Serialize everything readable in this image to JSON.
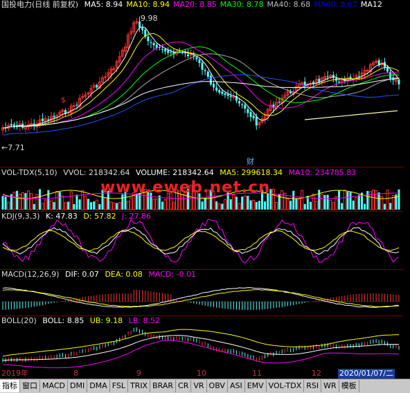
{
  "main": {
    "title": "国投电力(日线 前复权)",
    "ma": [
      {
        "label": "MA5: 8.94",
        "color": "#ffffff"
      },
      {
        "label": "MA10: 8.94",
        "color": "#ffff00"
      },
      {
        "label": "MA20: 8.85",
        "color": "#ff00ff"
      },
      {
        "label": "MA30: 8.78",
        "color": "#00ff00"
      },
      {
        "label": "MA40: 8.68",
        "color": "#bbbbbb"
      },
      {
        "label": "MA60: 8.67",
        "color": "#0000ff"
      },
      {
        "label": "MA12",
        "color": "#ffffff"
      }
    ],
    "high_label": "9.98",
    "low_label": "7.71",
    "markers": {
      "dollar": "$",
      "cai": "财"
    }
  },
  "vol": {
    "name": "VOL-TDX(5,10)",
    "vvol": "VVOL: 218342.64",
    "volume": "VOLUME: 218342.64",
    "ma5": "MA5: 299618.34",
    "ma10": "MA10: 234785.83",
    "colors": {
      "name": "#ddd",
      "vvol": "#ddd",
      "volume": "#ffffff",
      "ma5": "#ffff00",
      "ma10": "#ff00ff"
    }
  },
  "watermark": "www.eweb.net.cn",
  "kdj": {
    "name": "KDJ(9,3,3)",
    "k": "K: 47.83",
    "d": "D: 57.82",
    "j": "J: 27.86",
    "colors": {
      "name": "#ddd",
      "k": "#ffffff",
      "d": "#ffff00",
      "j": "#ff00ff"
    }
  },
  "macd": {
    "name": "MACD(12,26,9)",
    "dif": "DIF: 0.07",
    "dea": "DEA: 0.08",
    "macd": "MACD: -0.01",
    "colors": {
      "name": "#ddd",
      "dif": "#ffffff",
      "dea": "#ffff00",
      "macd": "#ff00ff"
    }
  },
  "boll": {
    "name": "BOLL(20)",
    "boll": "BOLL: 8.85",
    "ub": "UB: 9.18",
    "lb": "LB: 8.52",
    "colors": {
      "name": "#ddd",
      "boll": "#ffffff",
      "ub": "#ffff00",
      "lb": "#ff00ff"
    }
  },
  "xaxis": {
    "labels": [
      "2019年",
      "8",
      "9",
      "10",
      "11",
      "12"
    ],
    "date": "2020/01/07/二"
  },
  "tabs": [
    "指标",
    "窗口",
    "MACD",
    "DMI",
    "DMA",
    "FSL",
    "TRIX",
    "BRAR",
    "CR",
    "VR",
    "OBV",
    "ASI",
    "EMV",
    "VOL-TDX",
    "RSI",
    "WR",
    "模板"
  ]
}
